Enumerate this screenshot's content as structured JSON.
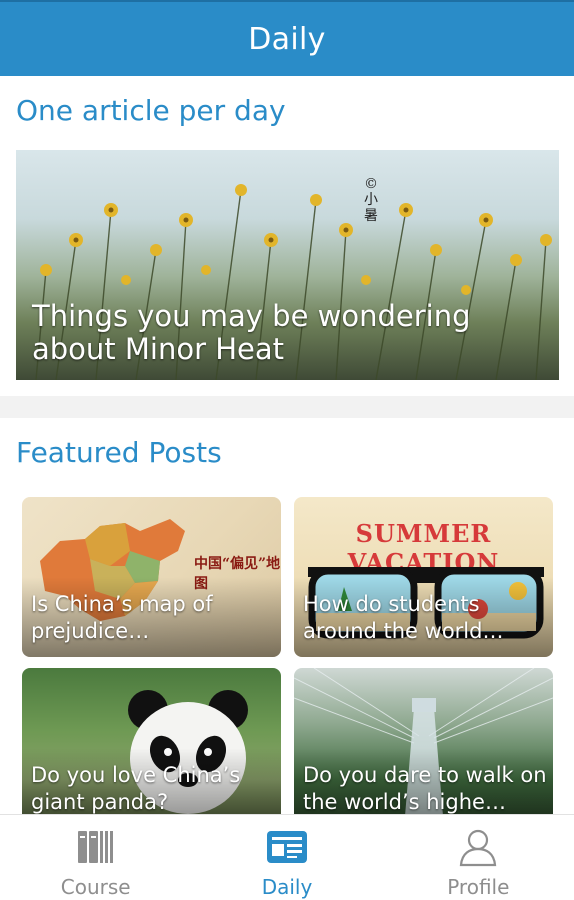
{
  "header": {
    "title": "Daily"
  },
  "daily": {
    "section_title": "One article per day",
    "hero": {
      "caption": "Things you may be wondering about Minor Heat",
      "seal_text": "©小暑"
    }
  },
  "featured": {
    "section_title": "Featured Posts",
    "posts": [
      {
        "caption": "Is China’s map of prejudice…",
        "art_text": "中国“偏见”地图"
      },
      {
        "caption": "How do students around the world…",
        "art_text": "SUMMER VACATION"
      },
      {
        "caption": "Do you love China’s giant panda?"
      },
      {
        "caption": "Do you dare to walk on the world’s highe…"
      }
    ]
  },
  "tabbar": {
    "tabs": [
      {
        "label": "Course",
        "icon": "books-icon",
        "active": false
      },
      {
        "label": "Daily",
        "icon": "newspaper-icon",
        "active": true
      },
      {
        "label": "Profile",
        "icon": "person-icon",
        "active": false
      }
    ]
  },
  "colors": {
    "accent": "#2a8cc8",
    "tab_inactive": "#8e8e8e",
    "background": "#f2f2f2"
  }
}
